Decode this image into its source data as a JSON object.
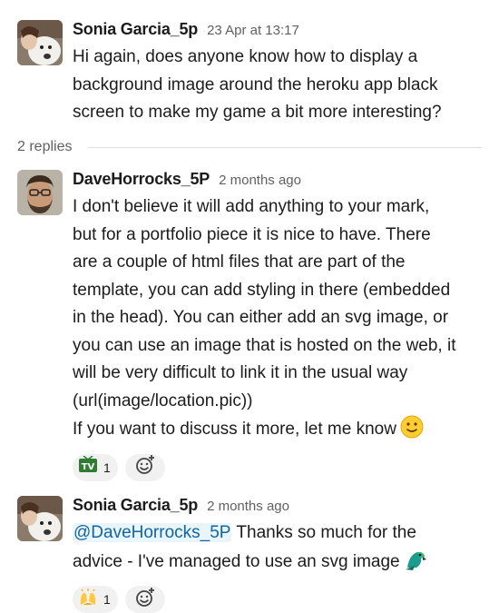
{
  "messages": [
    {
      "author": "Sonia Garcia_5p",
      "timestamp": "23 Apr at 13:17",
      "lines": [
        "Hi again, does anyone know how to display a",
        "background image around the heroku app black",
        "screen to make my game a bit more interesting?"
      ]
    },
    {
      "author": "DaveHorrocks_5P",
      "timestamp": "2 months ago",
      "lines": [
        "I don't believe it will add anything to your mark,",
        "but for a portfolio piece it is nice to have. There",
        "are a couple of html files that are part of the",
        "template, you can add styling in there (embedded",
        "in the head). You can either add an svg image, or",
        "you can use an image that is hosted on the web, it",
        "will be very difficult to link it in the usual way",
        "(url(image/location.pic))",
        "If you want to discuss it more, let me know"
      ],
      "inline_emoji": "slightly-smiling-face-emoji",
      "reactions": [
        {
          "emoji": "tv-emoji",
          "count": "1"
        }
      ]
    },
    {
      "author": "Sonia Garcia_5p",
      "timestamp": "2 months ago",
      "mention": "@DaveHorrocks_5P",
      "lines": [
        " Thanks so much for the",
        "advice - I've managed to use an svg image"
      ],
      "inline_emoji": "parrot-emoji",
      "reactions": [
        {
          "emoji": "raised-hands-emoji",
          "count": "1"
        }
      ]
    }
  ],
  "thread": {
    "replies_label": "2 replies"
  },
  "colors": {
    "link": "#1264a3",
    "mention_bg": "#e8f5fa",
    "muted": "#616061",
    "reaction_bg": "#f1f1f1"
  }
}
